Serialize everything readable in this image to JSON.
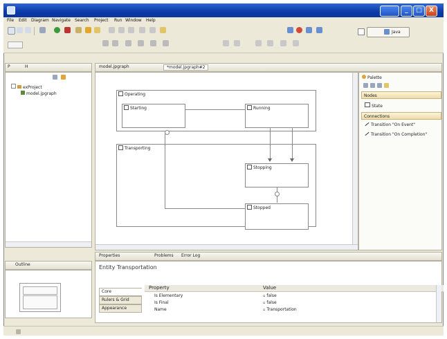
{
  "window": {
    "title": "",
    "controls": {
      "minimize": "_",
      "maximize": "□",
      "close": "X"
    }
  },
  "menu": [
    "File",
    "Edit",
    "Diagram",
    "Navigate",
    "Search",
    "Project",
    "Run",
    "Window",
    "Help"
  ],
  "perspective": {
    "label": "Java"
  },
  "project_explorer": {
    "tabs": [
      "P",
      "H"
    ],
    "project": "exProject",
    "file": "model.jpgraph"
  },
  "editor": {
    "tabs": [
      "model.jpgraph",
      "*model.jpgraph#2"
    ],
    "nodes": {
      "operating": "Operating",
      "starting": "Starting",
      "running": "Running",
      "transporting": "Transporting",
      "stopping": "Stopping",
      "stopped": "Stopped"
    }
  },
  "palette": {
    "title": "Palette",
    "nodes_drawer": "Nodes",
    "state_item": "State",
    "connections_drawer": "Connections",
    "conn_event": "Transition \"On Event\"",
    "conn_completion": "Transition \"On Completion\""
  },
  "outline": {
    "title": "Outline"
  },
  "bottom": {
    "tabs": [
      "Properties",
      "Problems",
      "Error Log"
    ],
    "entity_title": "Entity Transportation",
    "side_tabs": [
      "Core",
      "Rulers & Grid",
      "Appearance"
    ],
    "columns": [
      "Property",
      "Value"
    ],
    "rows": [
      {
        "property": "Is Elementary",
        "value": "false"
      },
      {
        "property": "Is Final",
        "value": "false"
      },
      {
        "property": "Name",
        "value": "Transportation"
      }
    ]
  },
  "colors": {
    "titlebar": "#0a3aa6",
    "chrome": "#ece9d8",
    "drawer": "#efdcaa",
    "close": "#c9421c"
  }
}
